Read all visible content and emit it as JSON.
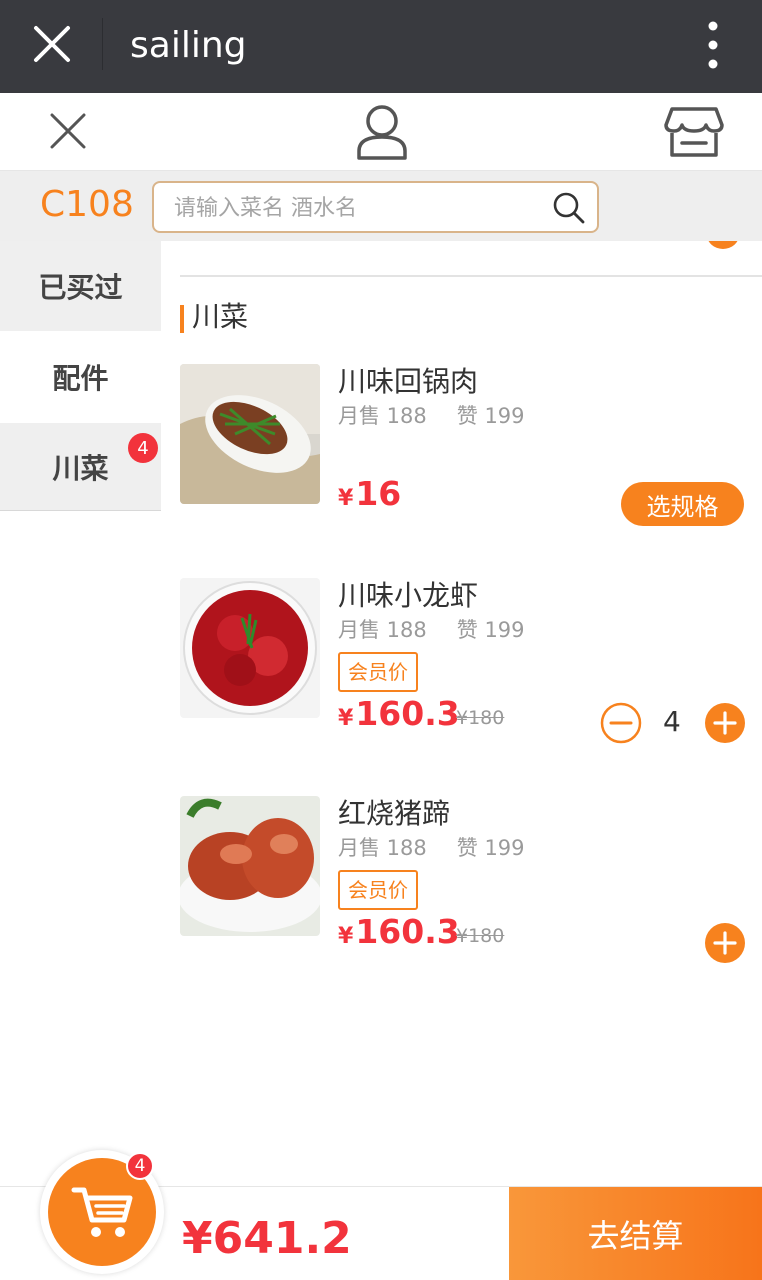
{
  "titlebar": {
    "title": "sailing"
  },
  "search": {
    "table_code": "C108",
    "placeholder": "请输入菜名 酒水名"
  },
  "sidebar": {
    "items": [
      {
        "label": "已买过"
      },
      {
        "label": "配件"
      },
      {
        "label": "川菜",
        "badge": "4"
      }
    ]
  },
  "category": {
    "title": "川菜"
  },
  "products": [
    {
      "name": "川味回锅肉",
      "sales": "月售 188",
      "likes": "赞 199",
      "currency": "¥",
      "price": "16",
      "spec_label": "选规格"
    },
    {
      "name": "川味小龙虾",
      "sales": "月售 188",
      "likes": "赞 199",
      "tag": "会员价",
      "currency": "¥",
      "price": "160.3",
      "original_price": "¥180",
      "qty": "4"
    },
    {
      "name": "红烧猪蹄",
      "sales": "月售 188",
      "likes": "赞 199",
      "tag": "会员价",
      "currency": "¥",
      "price": "160.3",
      "original_price": "¥180"
    }
  ],
  "cart": {
    "count": "4",
    "total": "¥641.2",
    "checkout_label": "去结算"
  },
  "colors": {
    "accent": "#f7821e",
    "price": "#f2333c",
    "titlebar": "#393a3f"
  },
  "icons": [
    "close-icon",
    "more-icon",
    "user-icon",
    "store-icon",
    "search-icon",
    "minus-icon",
    "plus-icon",
    "cart-icon"
  ]
}
